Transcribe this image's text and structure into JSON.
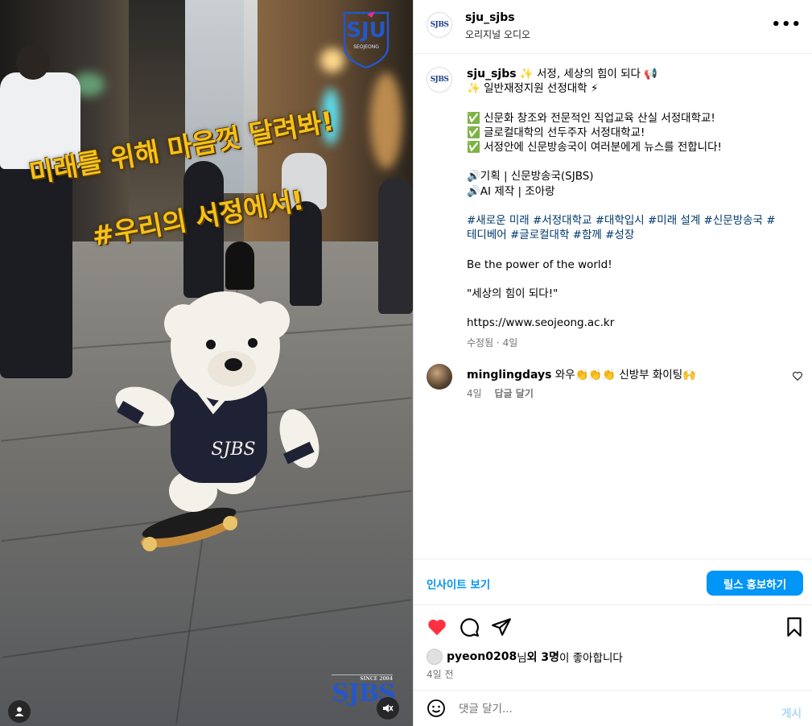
{
  "media": {
    "logo_top": "SJU",
    "logo_sub": "SEOJEONG",
    "overlay_line1": "미래를 위해 마음껏 달려봐!",
    "overlay_line2": "#우리의 서정에서!",
    "jacket_text": "SJBS",
    "watermark_since": "SINCE 2004",
    "watermark_logo": "SJBS",
    "user_icon": "user-icon",
    "mute_icon": "muted-speaker-icon"
  },
  "header": {
    "avatar_text": "SJBS",
    "username": "sju_sjbs",
    "audio": "오리지널 오디오",
    "more_icon": "more-dots-icon"
  },
  "caption": {
    "avatar_text": "SJBS",
    "username": "sju_sjbs",
    "lines": [
      "✨ 서정, 세상의 힘이 되다 📢",
      "✨ 일반재정지원 선정대학 ⚡",
      "",
      "✅ 신문화 창조와 전문적인 직업교육 산실 서정대학교!",
      "✅ 글로컬대학의 선두주자 서정대학교!",
      "✅ 서정안에 신문방송국이 여러분에게 뉴스를 전합니다!",
      "",
      "🔊기획 | 신문방송국(SJBS)",
      "🔊AI 제작 | 조아랑",
      ""
    ],
    "hashtags_line1": "#새로운 미래 #서정대학교 #대학입시 #미래 설계 #신문방송국 #",
    "hashtags_line2": "테디베어 #글로컬대학 #함께 #성장",
    "english_line": "Be the power of the world!",
    "quote_line": "\"세상의 힘이 되다!\"",
    "url": "https://www.seojeong.ac.kr",
    "edited_meta": "수정됨 · 4일"
  },
  "comment": {
    "username": "minglingdays",
    "text": "와우👏👏👏 신방부 화이팅🙌",
    "time": "4일",
    "reply": "답글 달기"
  },
  "insight": {
    "link": "인사이트 보기",
    "promote": "릴스 홍보하기"
  },
  "likes": {
    "user": "pyeon0208",
    "suffix1": "님 ",
    "others": "외 3명",
    "suffix2": "이 좋아합니다",
    "ago": "4일 전"
  },
  "composer": {
    "placeholder": "댓글 달기...",
    "post": "게시",
    "emoji_icon": "emoji-smiley-icon"
  },
  "colors": {
    "accent": "#0095f6",
    "like": "#ff3040",
    "hashtag": "#00376b",
    "overlay_text": "#f4c21a"
  }
}
